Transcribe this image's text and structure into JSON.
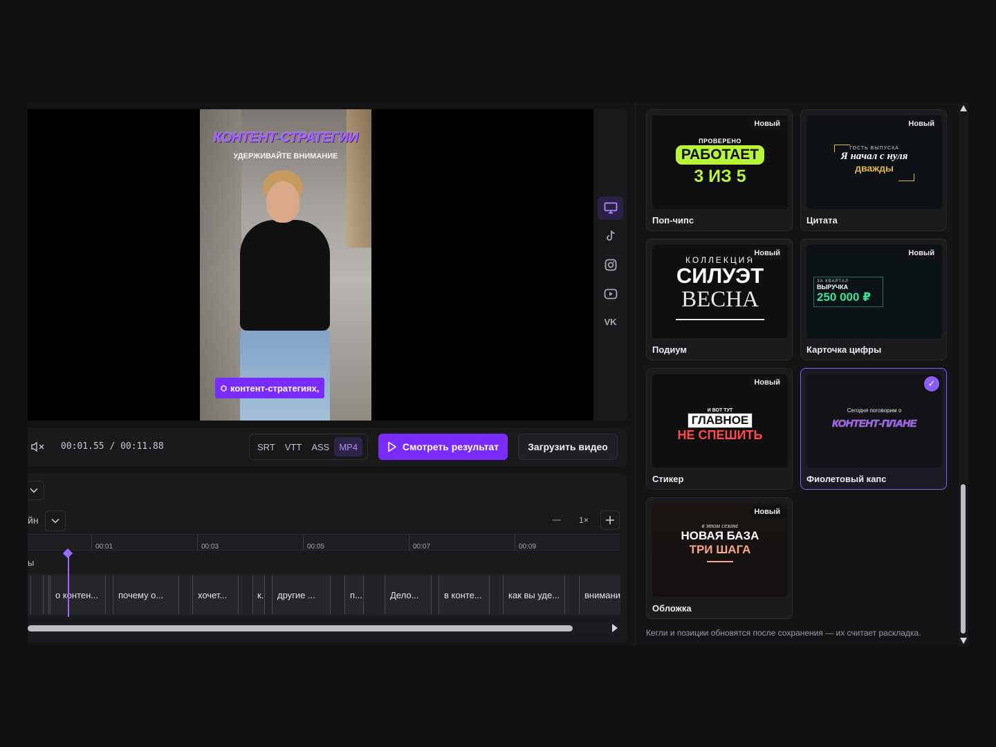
{
  "preview": {
    "caption_title": "КОНТЕНТ-СТРАТЕГИИ",
    "caption_sub": "УДЕРЖИВАЙТЕ ВНИМАНИЕ",
    "caption_chip": "контент-стратегиях,"
  },
  "platforms": [
    "desktop-icon",
    "tiktok-icon",
    "instagram-icon",
    "youtube-icon",
    "VK"
  ],
  "controls": {
    "time": "00:01.55 / 00:11.88",
    "formats": [
      "SRT",
      "VTT",
      "ASS",
      "MP4"
    ],
    "active_format": "MP4",
    "play_label": "Смотреть результат",
    "upload_label": "Загрузить видео"
  },
  "timeline": {
    "row_label": "йн",
    "zoom": "1×",
    "ticks": [
      "00:01",
      "00:03",
      "00:05",
      "00:07",
      "00:09"
    ],
    "track_label": "ы",
    "clips": [
      "о контен...",
      "почему о...",
      "хочет...",
      "к.",
      "другие ...",
      "п...",
      "Дело...",
      "в конте...",
      "как вы уде...",
      "внимани"
    ]
  },
  "styles": {
    "new_badge": "Новый",
    "cards": [
      {
        "label": "Поп-чипс",
        "new": true,
        "lines": [
          "ПРОВЕРЕНО",
          "РАБОТАЕТ",
          "3 ИЗ 5"
        ]
      },
      {
        "label": "Цитата",
        "new": true,
        "lines": [
          "ГОСТЬ ВЫПУСКА",
          "Я начал с нуля",
          "дважды"
        ]
      },
      {
        "label": "Подиум",
        "new": true,
        "lines": [
          "КОЛЛЕКЦИЯ",
          "СИЛУЭТ",
          "ВЕСНА"
        ]
      },
      {
        "label": "Карточка цифры",
        "new": true,
        "lines": [
          "ЗА КВАРТАЛ",
          "ВЫРУЧКА",
          "250 000 ₽"
        ]
      },
      {
        "label": "Стикер",
        "new": true,
        "lines": [
          "И ВОТ ТУТ",
          "ГЛАВНОЕ",
          "НЕ СПЕШИТЬ"
        ]
      },
      {
        "label": "Фиолетовый капс",
        "new": false,
        "selected": true,
        "lines": [
          "Сегодня поговорим о",
          "КОНТЕНТ-ПЛАНЕ"
        ]
      },
      {
        "label": "Обложка",
        "new": true,
        "lines": [
          "в этом сезоне",
          "НОВАЯ БАЗА",
          "ТРИ ШАГА"
        ]
      }
    ],
    "note": "Кегли и позиции обновятся после сохранения — их считает раскладка."
  },
  "colors": {
    "accent": "#7a2cff",
    "background": "#141416",
    "panel": "#1a1a1d"
  }
}
